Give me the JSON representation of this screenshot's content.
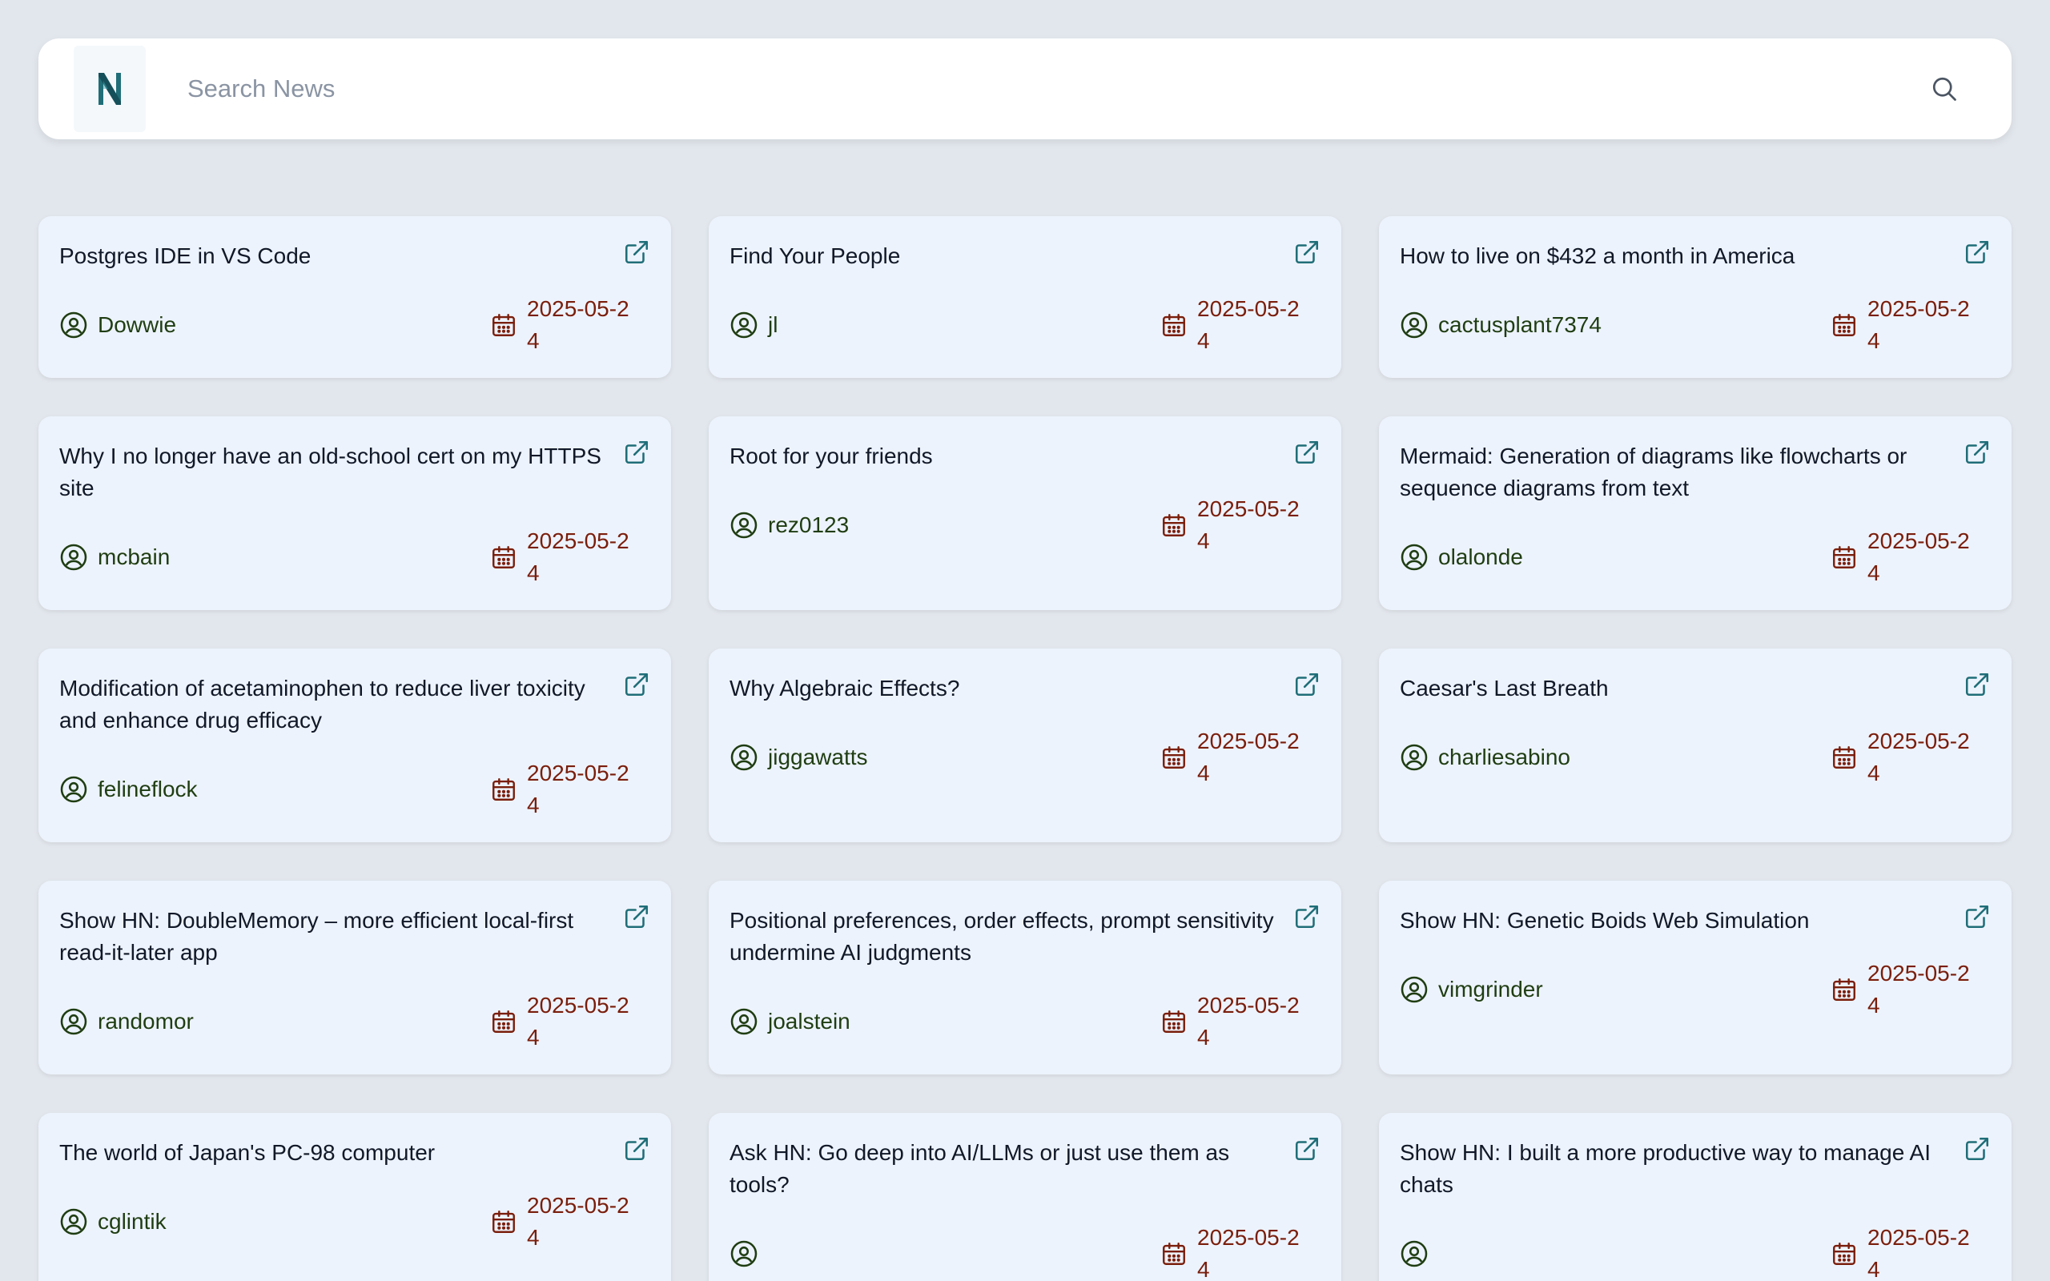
{
  "search": {
    "placeholder": "Search News",
    "value": ""
  },
  "colors": {
    "background": "#e2e7ed",
    "card": "#edf3fc",
    "logo": "#1f6e78",
    "author": "#1f3d12",
    "date": "#7a1e0c",
    "link_icon": "#1f6e78"
  },
  "icons": {
    "logo": "n-logo-icon",
    "search": "search-icon",
    "author": "user-circle-icon",
    "date": "calendar-icon",
    "link": "external-link-icon"
  },
  "news": [
    {
      "title": "Postgres IDE in VS Code",
      "author": "Dowwie",
      "date": "2025-05-24"
    },
    {
      "title": "Find Your People",
      "author": "jl",
      "date": "2025-05-24"
    },
    {
      "title": "How to live on $432 a month in America",
      "author": "cactusplant7374",
      "date": "2025-05-24"
    },
    {
      "title": "Why I no longer have an old-school cert on my HTTPS site",
      "author": "mcbain",
      "date": "2025-05-24"
    },
    {
      "title": "Root for your friends",
      "author": "rez0123",
      "date": "2025-05-24"
    },
    {
      "title": "Mermaid: Generation of diagrams like flowcharts or sequence diagrams from text",
      "author": "olalonde",
      "date": "2025-05-24"
    },
    {
      "title": "Modification of acetaminophen to reduce liver toxicity and enhance drug efficacy",
      "author": "felineflock",
      "date": "2025-05-24"
    },
    {
      "title": "Why Algebraic Effects?",
      "author": "jiggawatts",
      "date": "2025-05-24"
    },
    {
      "title": "Caesar's Last Breath",
      "author": "charliesabino",
      "date": "2025-05-24"
    },
    {
      "title": "Show HN: DoubleMemory – more efficient local-first read-it-later app",
      "author": "randomor",
      "date": "2025-05-24"
    },
    {
      "title": "Positional preferences, order effects, prompt sensitivity undermine AI judgments",
      "author": "joalstein",
      "date": "2025-05-24"
    },
    {
      "title": "Show HN: Genetic Boids Web Simulation",
      "author": "vimgrinder",
      "date": "2025-05-24"
    },
    {
      "title": "The world of Japan's PC-98 computer",
      "author": "cglintik",
      "date": "2025-05-24"
    },
    {
      "title": "Ask HN: Go deep into AI/LLMs or just use them as tools?",
      "author": "",
      "date": "2025-05-24"
    },
    {
      "title": "Show HN: I built a more productive way to manage AI chats",
      "author": "",
      "date": "2025-05-24"
    }
  ]
}
